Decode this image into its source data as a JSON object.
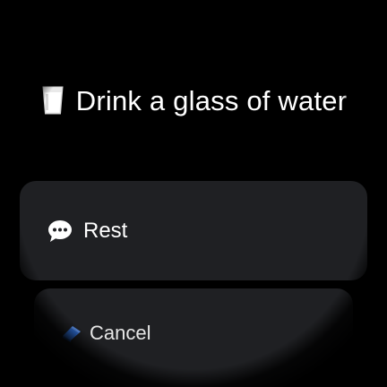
{
  "prompt": {
    "title": "Drink a glass of water",
    "icon": "glass-of-milk-icon"
  },
  "actions": [
    {
      "label": "Rest",
      "icon": "speech-bubble-icon"
    },
    {
      "label": "Cancel",
      "icon": "eraser-icon"
    }
  ],
  "colors": {
    "background": "#000000",
    "chip": "#1f2023",
    "text": "#ffffff",
    "eraser_blue": "#1f5fbf"
  }
}
